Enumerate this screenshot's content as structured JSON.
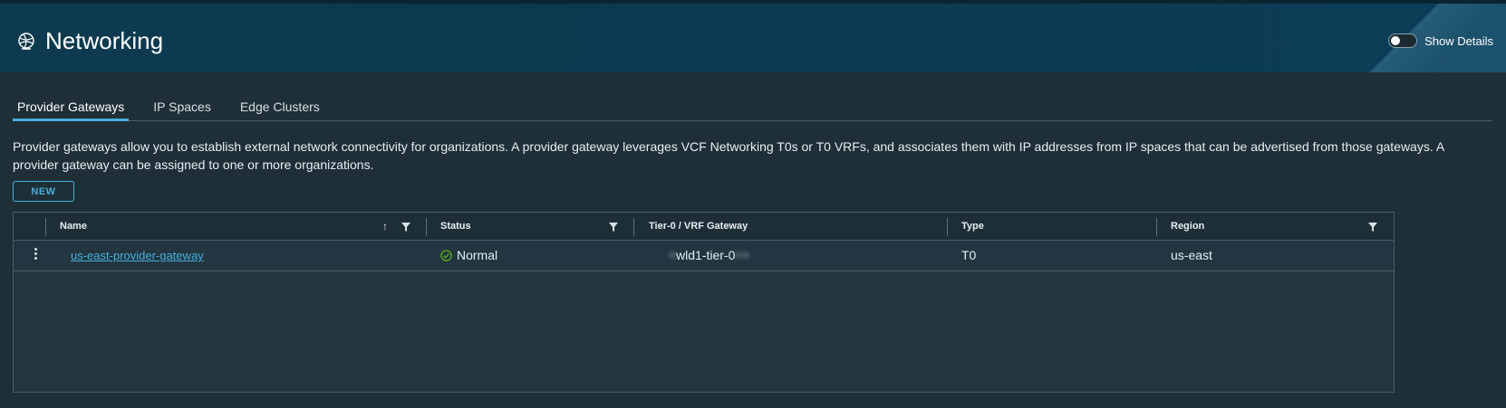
{
  "header": {
    "title": "Networking",
    "icon": "globe-icon",
    "show_details_label": "Show Details",
    "show_details_on": false
  },
  "tabs": [
    {
      "label": "Provider Gateways",
      "active": true
    },
    {
      "label": "IP Spaces",
      "active": false
    },
    {
      "label": "Edge Clusters",
      "active": false
    }
  ],
  "description": "Provider gateways allow you to establish external network connectivity for organizations. A provider gateway leverages VCF Networking T0s or T0 VRFs, and associates them with IP addresses from IP spaces that can be advertised from those gateways. A provider gateway can be assigned to one or more organizations.",
  "new_button_label": "NEW",
  "grid": {
    "columns": [
      "Name",
      "Status",
      "Tier-0 / VRF Gateway",
      "Type",
      "Region"
    ],
    "rows": [
      {
        "name": "us-east-provider-gateway",
        "status": "Normal",
        "gateway": "wld1-tier-0",
        "type": "T0",
        "region": "us-east"
      }
    ]
  },
  "colors": {
    "accent": "#49afd9",
    "header_bg": "#0d3a4e",
    "page_bg": "#1f2f38",
    "status_ok": "#5eb715"
  }
}
